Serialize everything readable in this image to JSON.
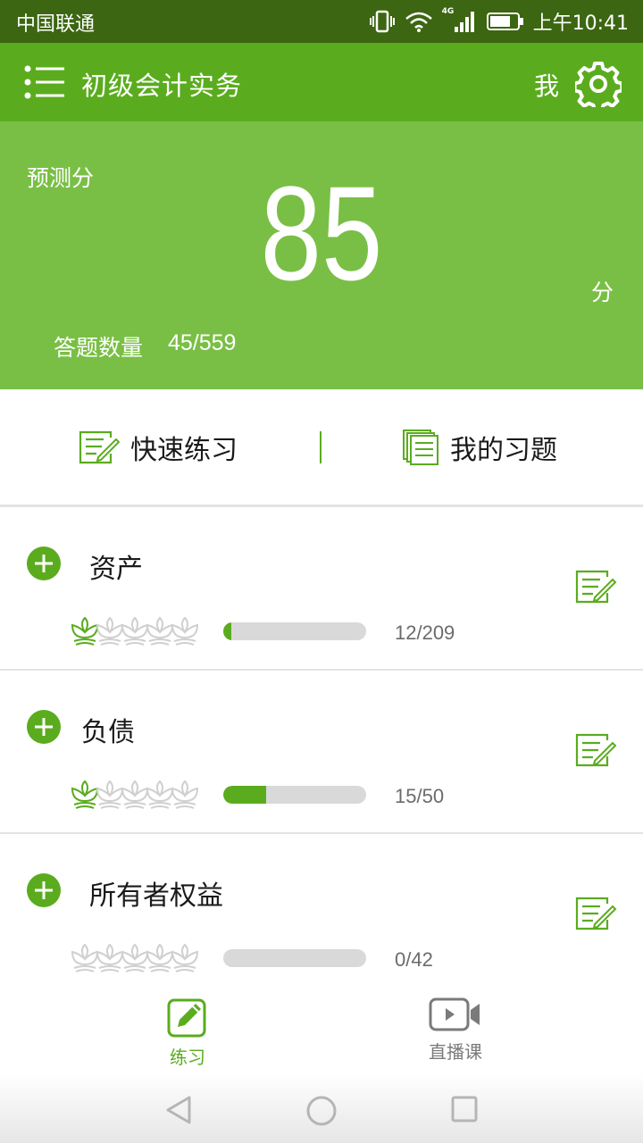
{
  "status_bar": {
    "carrier": "中国联通",
    "network": "4G",
    "time": "上午10:41"
  },
  "app_bar": {
    "title": "初级会计实务",
    "me_label": "我"
  },
  "hero": {
    "label": "预测分",
    "score": "85",
    "unit": "分",
    "count_label": "答题数量",
    "count_value": "45/559"
  },
  "actions": {
    "quick_practice": "快速练习",
    "my_questions": "我的习题"
  },
  "chapters": [
    {
      "title": "资产",
      "progress": "12/209",
      "fraction": 0.057,
      "stars_earned": 1,
      "stars_total": 5
    },
    {
      "title": "负债",
      "progress": "15/50",
      "fraction": 0.3,
      "stars_earned": 1,
      "stars_total": 5
    },
    {
      "title": "所有者权益",
      "progress": "0/42",
      "fraction": 0.0,
      "stars_earned": 0,
      "stars_total": 5
    }
  ],
  "bottom_nav": {
    "items": [
      {
        "label": "练习",
        "icon": "pencil-edit-icon",
        "active": true
      },
      {
        "label": "直播课",
        "icon": "video-camera-icon",
        "active": false
      }
    ]
  },
  "colors": {
    "status_bar": "#3c6611",
    "primary": "#5aac1e",
    "hero": "#79bf45",
    "inactive": "#7a7a7a"
  }
}
